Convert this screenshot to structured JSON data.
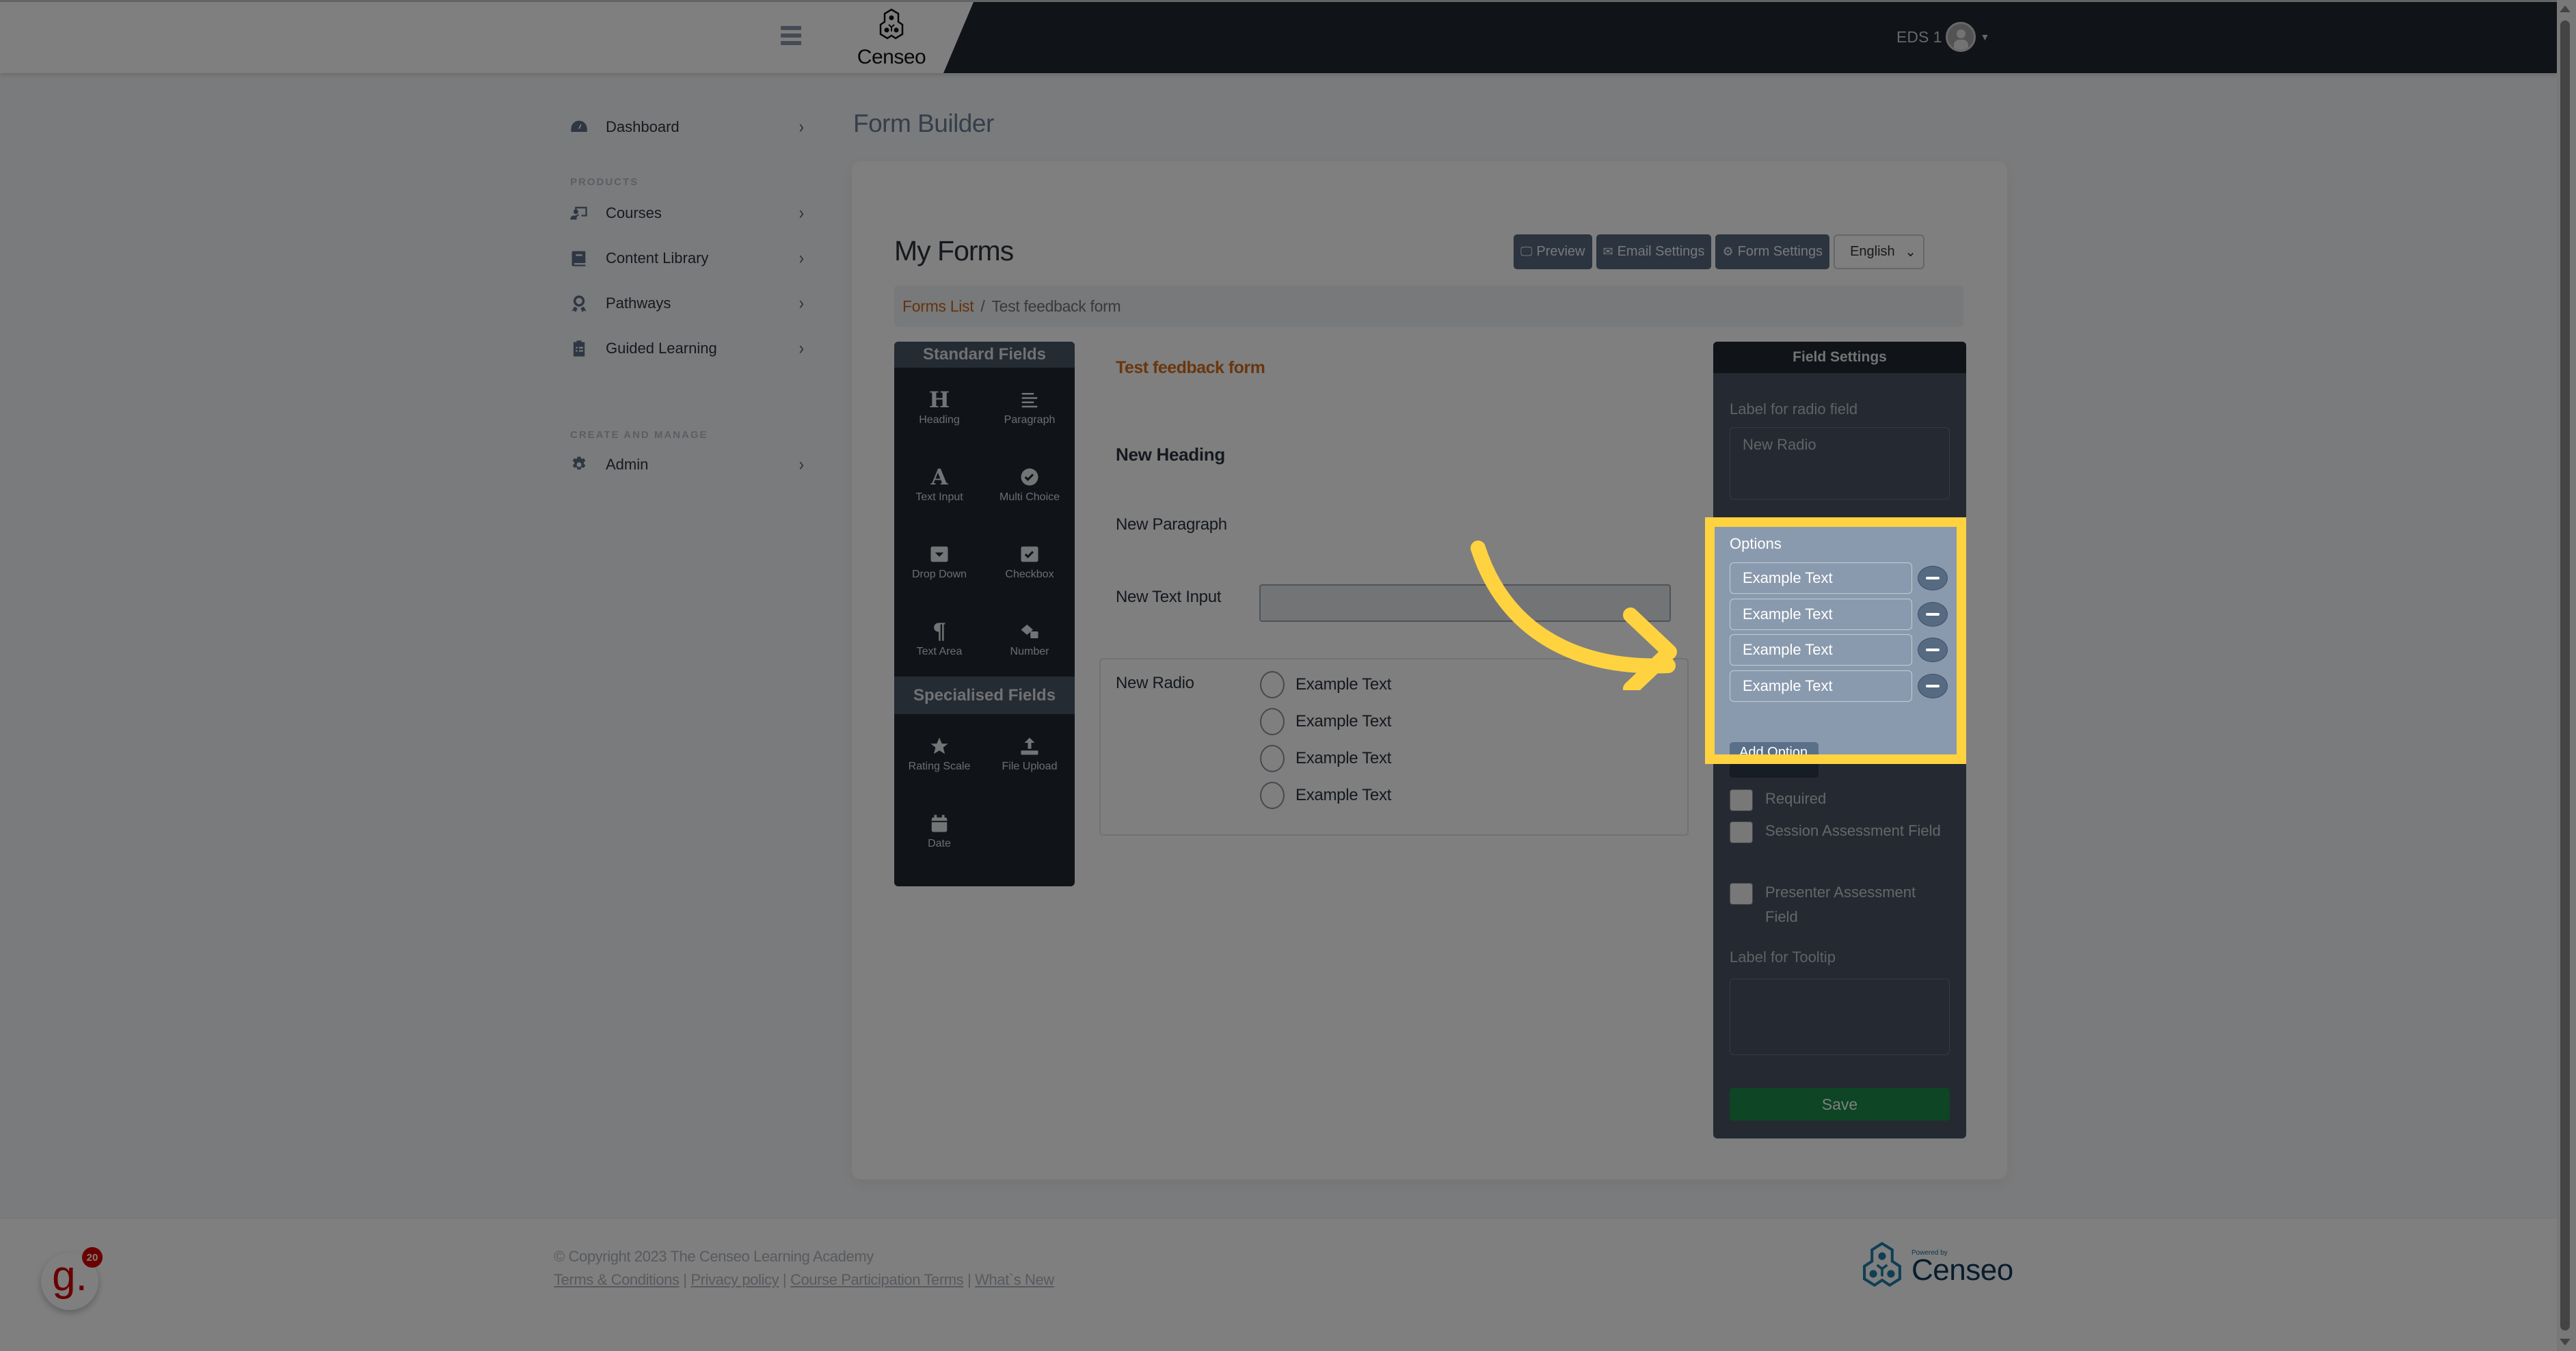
{
  "header": {
    "logo_text": "Censeo",
    "user_name": "EDS 1"
  },
  "sidebar": {
    "items": [
      {
        "label": "Dashboard",
        "icon": "dashboard-icon"
      },
      {
        "label": "Courses",
        "icon": "courses-icon"
      },
      {
        "label": "Content Library",
        "icon": "book-icon"
      },
      {
        "label": "Pathways",
        "icon": "award-icon"
      },
      {
        "label": "Guided Learning",
        "icon": "clipboard-list-icon"
      },
      {
        "label": "Admin",
        "icon": "gear-icon"
      }
    ],
    "sections": [
      "PRODUCTS",
      "CREATE AND MANAGE"
    ]
  },
  "page": {
    "title": "Form Builder",
    "card_title": "My Forms",
    "toolbar": {
      "preview": "Preview",
      "email_settings": "Email Settings",
      "form_settings": "Form Settings",
      "language": "English"
    },
    "breadcrumb": {
      "link": "Forms List",
      "separator": "/",
      "current": "Test feedback form"
    }
  },
  "palette": {
    "standard_title": "Standard Fields",
    "standard": [
      {
        "label": "Heading",
        "icon": "heading-icon"
      },
      {
        "label": "Paragraph",
        "icon": "paragraph-icon"
      },
      {
        "label": "Text Input",
        "icon": "text-input-icon"
      },
      {
        "label": "Multi Choice",
        "icon": "check-circle-icon"
      },
      {
        "label": "Drop Down",
        "icon": "dropdown-icon"
      },
      {
        "label": "Checkbox",
        "icon": "checkbox-icon"
      },
      {
        "label": "Text Area",
        "icon": "pilcrow-icon"
      },
      {
        "label": "Number",
        "icon": "dice-icon"
      }
    ],
    "specialised_title": "Specialised Fields",
    "specialised": [
      {
        "label": "Rating Scale",
        "icon": "star-icon"
      },
      {
        "label": "File Upload",
        "icon": "upload-icon"
      },
      {
        "label": "Date",
        "icon": "calendar-icon"
      }
    ]
  },
  "canvas": {
    "form_title": "Test feedback form",
    "heading": "New Heading",
    "paragraph": "New Paragraph",
    "text_input_label": "New Text Input",
    "radio_label": "New Radio",
    "radio_options": [
      "Example Text",
      "Example Text",
      "Example Text",
      "Example Text"
    ]
  },
  "field_settings": {
    "title": "Field Settings",
    "label_caption": "Label for radio field",
    "label_value": "New Radio",
    "options_caption": "Options",
    "options": [
      "Example Text",
      "Example Text",
      "Example Text",
      "Example Text"
    ],
    "add_option": "Add Option",
    "checkboxes": [
      {
        "label": "Required",
        "checked": false
      },
      {
        "label": "Session Assessment Field",
        "checked": false
      },
      {
        "label": "Presenter Assessment Field",
        "checked": false
      }
    ],
    "tooltip_caption": "Label for Tooltip",
    "tooltip_value": "",
    "save": "Save"
  },
  "footer": {
    "copyright": "© Copyright 2023 The Censeo Learning Academy",
    "links": [
      "Terms & Conditions",
      "Privacy policy",
      "Course Participation Terms",
      "What`s New"
    ],
    "separator": "|",
    "powered_by": "Powered by",
    "powered_name": "Censeo"
  },
  "badge": {
    "letter": "g.",
    "count": "20"
  },
  "colors": {
    "highlight": "#ffd340",
    "accent": "#d36d1c",
    "nav_dark": "#202833",
    "save_green": "#1a8a4a"
  }
}
